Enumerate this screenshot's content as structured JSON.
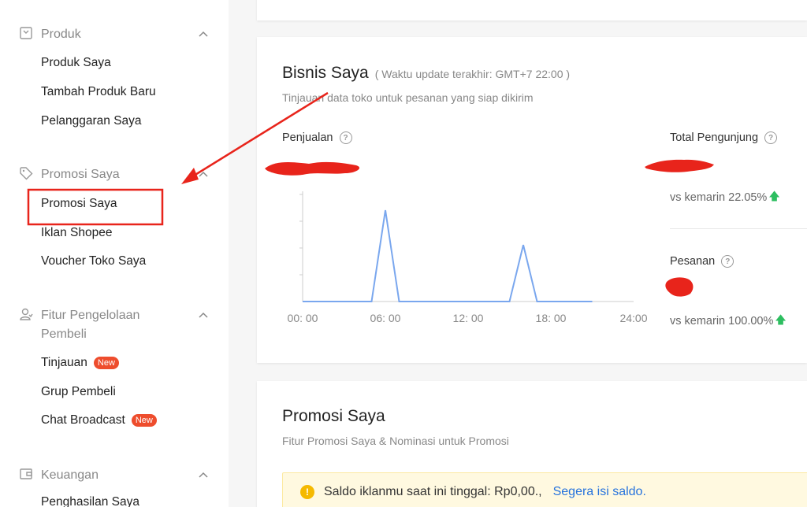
{
  "sidebar": {
    "groups": [
      {
        "title": "Produk",
        "icon": "box-icon",
        "items": [
          {
            "label": "Produk Saya"
          },
          {
            "label": "Tambah Produk Baru"
          },
          {
            "label": "Pelanggaran Saya"
          }
        ]
      },
      {
        "title": "Promosi Saya",
        "icon": "tag-icon",
        "items": [
          {
            "label": "Promosi Saya"
          },
          {
            "label": "Iklan Shopee"
          },
          {
            "label": "Voucher Toko Saya"
          }
        ]
      },
      {
        "title_line1": "Fitur Pengelolaan",
        "title_line2": "Pembeli",
        "icon": "users-icon",
        "items": [
          {
            "label": "Tinjauan",
            "badge": "New"
          },
          {
            "label": "Grup Pembeli"
          },
          {
            "label": "Chat Broadcast",
            "badge": "New"
          }
        ]
      },
      {
        "title": "Keuangan",
        "icon": "wallet-icon",
        "items": [
          {
            "label": "Penghasilan Saya"
          }
        ]
      }
    ]
  },
  "bisnis": {
    "title": "Bisnis Saya",
    "update_time": "( Waktu update terakhir: GMT+7 22:00 )",
    "description": "Tinjauan data toko untuk pesanan yang siap dikirim",
    "sales_label": "Penjualan",
    "visitors_label": "Total Pengunjung",
    "visitors_change": "vs kemarin 22.05%",
    "orders_label": "Pesanan",
    "orders_change": "vs kemarin 100.00%"
  },
  "chart_data": {
    "type": "line",
    "x": [
      "00:00",
      "01:00",
      "02:00",
      "03:00",
      "04:00",
      "05:00",
      "06:00",
      "07:00",
      "08:00",
      "09:00",
      "10:00",
      "11:00",
      "12:00",
      "13:00",
      "14:00",
      "15:00",
      "16:00",
      "17:00",
      "18:00",
      "19:00",
      "20:00",
      "21:00"
    ],
    "series": [
      {
        "values": [
          0,
          0,
          0,
          0,
          0,
          0,
          1,
          0,
          0,
          0,
          0,
          0,
          0,
          0,
          0,
          0,
          0.62,
          0,
          0,
          0,
          0,
          0
        ]
      }
    ],
    "tick_labels": [
      "00: 00",
      "06: 00",
      "12: 00",
      "18: 00",
      "24:00"
    ],
    "line_color": "#7aa7ee"
  },
  "promo": {
    "title": "Promosi Saya",
    "description": "Fitur Promosi Saya & Nominasi untuk Promosi",
    "alert_text": "Saldo iklanmu saat ini tinggal: Rp0,00.,",
    "alert_link": "Segera isi saldo."
  },
  "colors": {
    "accent": "#ee4d2d",
    "annotation": "#e8241b",
    "link": "#2673dd",
    "up": "#2dbe60"
  }
}
